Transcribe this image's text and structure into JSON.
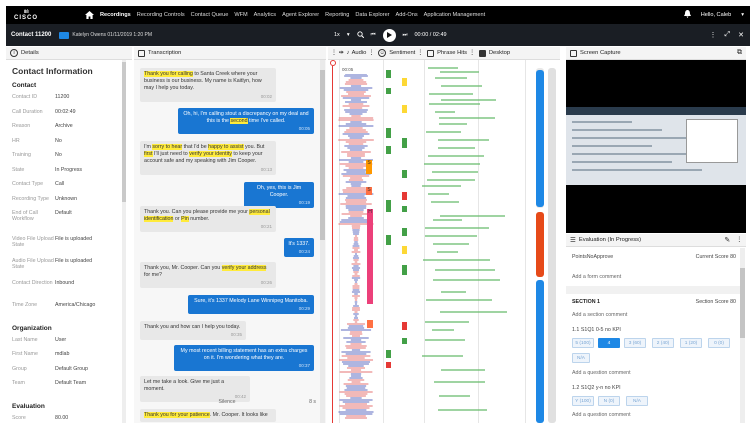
{
  "nav": {
    "logo_bars": "ılıılı",
    "logo_text": "CISCO",
    "items": [
      "Recordings",
      "Recording Controls",
      "Contact Queue",
      "WFM",
      "Analytics",
      "Agent Explorer",
      "Reporting",
      "Data Explorer",
      "Add-Ons",
      "Application Management"
    ],
    "user": "Hello, Caleb"
  },
  "contact": {
    "id": "Contact 11200",
    "agent": "Katelyn Owens  01/11/2019  1:20 PM",
    "speed": "1x",
    "time": "00:00 / 02:49"
  },
  "panels": {
    "details": "Details",
    "transcription": "Transcription",
    "audio": "Audio",
    "sentiment": "Sentiment",
    "phrase_hits": "Phrase Hits",
    "desktop": "Desktop",
    "screen_capture": "Screen Capture",
    "evaluation": "Evaluation (In Progress)"
  },
  "details": {
    "title": "Contact Information",
    "contact_section": "Contact",
    "fields": [
      {
        "k": "Contact ID",
        "v": "11200"
      },
      {
        "k": "Call Duration",
        "v": "00:02:49"
      },
      {
        "k": "Reason",
        "v": "Archive"
      },
      {
        "k": "HR",
        "v": "No"
      },
      {
        "k": "Training",
        "v": "No"
      },
      {
        "k": "State",
        "v": "In Progress"
      },
      {
        "k": "Contact Type",
        "v": "Call"
      },
      {
        "k": "Recording Type",
        "v": "Unknown"
      },
      {
        "k": "End of Call Workflow",
        "v": "Default"
      },
      {
        "k": "Video File Upload State",
        "v": "File is uploaded"
      },
      {
        "k": "Audio File Upload State",
        "v": "File is uploaded"
      },
      {
        "k": "Contact Direction",
        "v": "Inbound"
      },
      {
        "k": "Time Zone",
        "v": "America/Chicago"
      }
    ],
    "org_section": "Organization",
    "org_fields": [
      {
        "k": "Last Name",
        "v": "User"
      },
      {
        "k": "First Name",
        "v": "mdlab"
      },
      {
        "k": "Group",
        "v": "Default Group"
      },
      {
        "k": "Team",
        "v": "Default Team"
      }
    ],
    "eval_section": "Evaluation",
    "eval_fields": [
      {
        "k": "Score",
        "v": "80.00"
      }
    ]
  },
  "transcript": {
    "m1_a": "Thank you for calling",
    "m1_b": " to Santa Creek where your business is our business. My name is Kaitlyn, how may I help you today.",
    "m1_t": "00:02",
    "m2_a": "Oh, hi, I'm calling stout a discrepancy on my deal and this is the ",
    "m2_hl": "second",
    "m2_b": " time I've called.",
    "m2_t": "00:05",
    "m3_a": "I'm ",
    "m3_hl1": "sorry to hear",
    "m3_b": " that I'd be ",
    "m3_hl2": "happy to assist",
    "m3_c": " you. But ",
    "m3_hl3": "first",
    "m3_d": " I'll just need to ",
    "m3_hl4": "verify your identity",
    "m3_e": " to keep your account safe and my speaking with Jim Cooper.",
    "m3_t": "00:13",
    "m4": "Oh, yes, this is Jim Cooper.",
    "m4_t": "00:19",
    "m5_a": "Thank you. Can you please provide me your ",
    "m5_hl1": "personal identification",
    "m5_b": " or ",
    "m5_hl2": "Pin",
    "m5_c": " number.",
    "m5_t": "00:21",
    "m6": "It's 1337.",
    "m6_t": "00:24",
    "m7_a": "Thank you, Mr. Cooper. Can you ",
    "m7_hl": "verify your address",
    "m7_b": " for me?",
    "m7_t": "00:26",
    "m8": "Sure, it's 1337 Melody Lane Winnipeg Manitoba.",
    "m8_t": "00:29",
    "m9": "Thank you and how can I help you today.",
    "m9_t": "00:35",
    "m10": "My most recent billing statement has an extra charges on it. I'm wondering what they are.",
    "m10_t": "00:37",
    "m11": "Let me take a look. Give me just a moment.",
    "m11_t": "00:42",
    "silence": "Silence",
    "silence_len": "8 s",
    "m12_hl": "Thank you for your patience",
    "m12_b": ". Mr. Cooper. It looks like"
  },
  "audio": {
    "start_time": "00:05",
    "marker_s1": "S",
    "marker_s2": "S",
    "marker_h": "H"
  },
  "evaluation": {
    "form": "PointsNoApprove",
    "current_score_label": "Current Score 80",
    "add_comment": "Add a form comment",
    "section": "SECTION 1",
    "section_score": "Section Score 80",
    "add_section_comment": "Add a section comment",
    "q1": "1.1 S1Q1 0-5 no KPI",
    "q1_opts": [
      "5 (100)",
      "4",
      "3 (60)",
      "2 (40)",
      "1 (20)",
      "0 (0)"
    ],
    "q1_na": "N/A",
    "add_q_comment": "Add a question comment",
    "q2": "1.2 S1Q2 y-n no KPI",
    "q2_opts": [
      "Y (100)",
      "N (0)",
      "N/A"
    ],
    "add_q_comment2": "Add a question comment"
  }
}
